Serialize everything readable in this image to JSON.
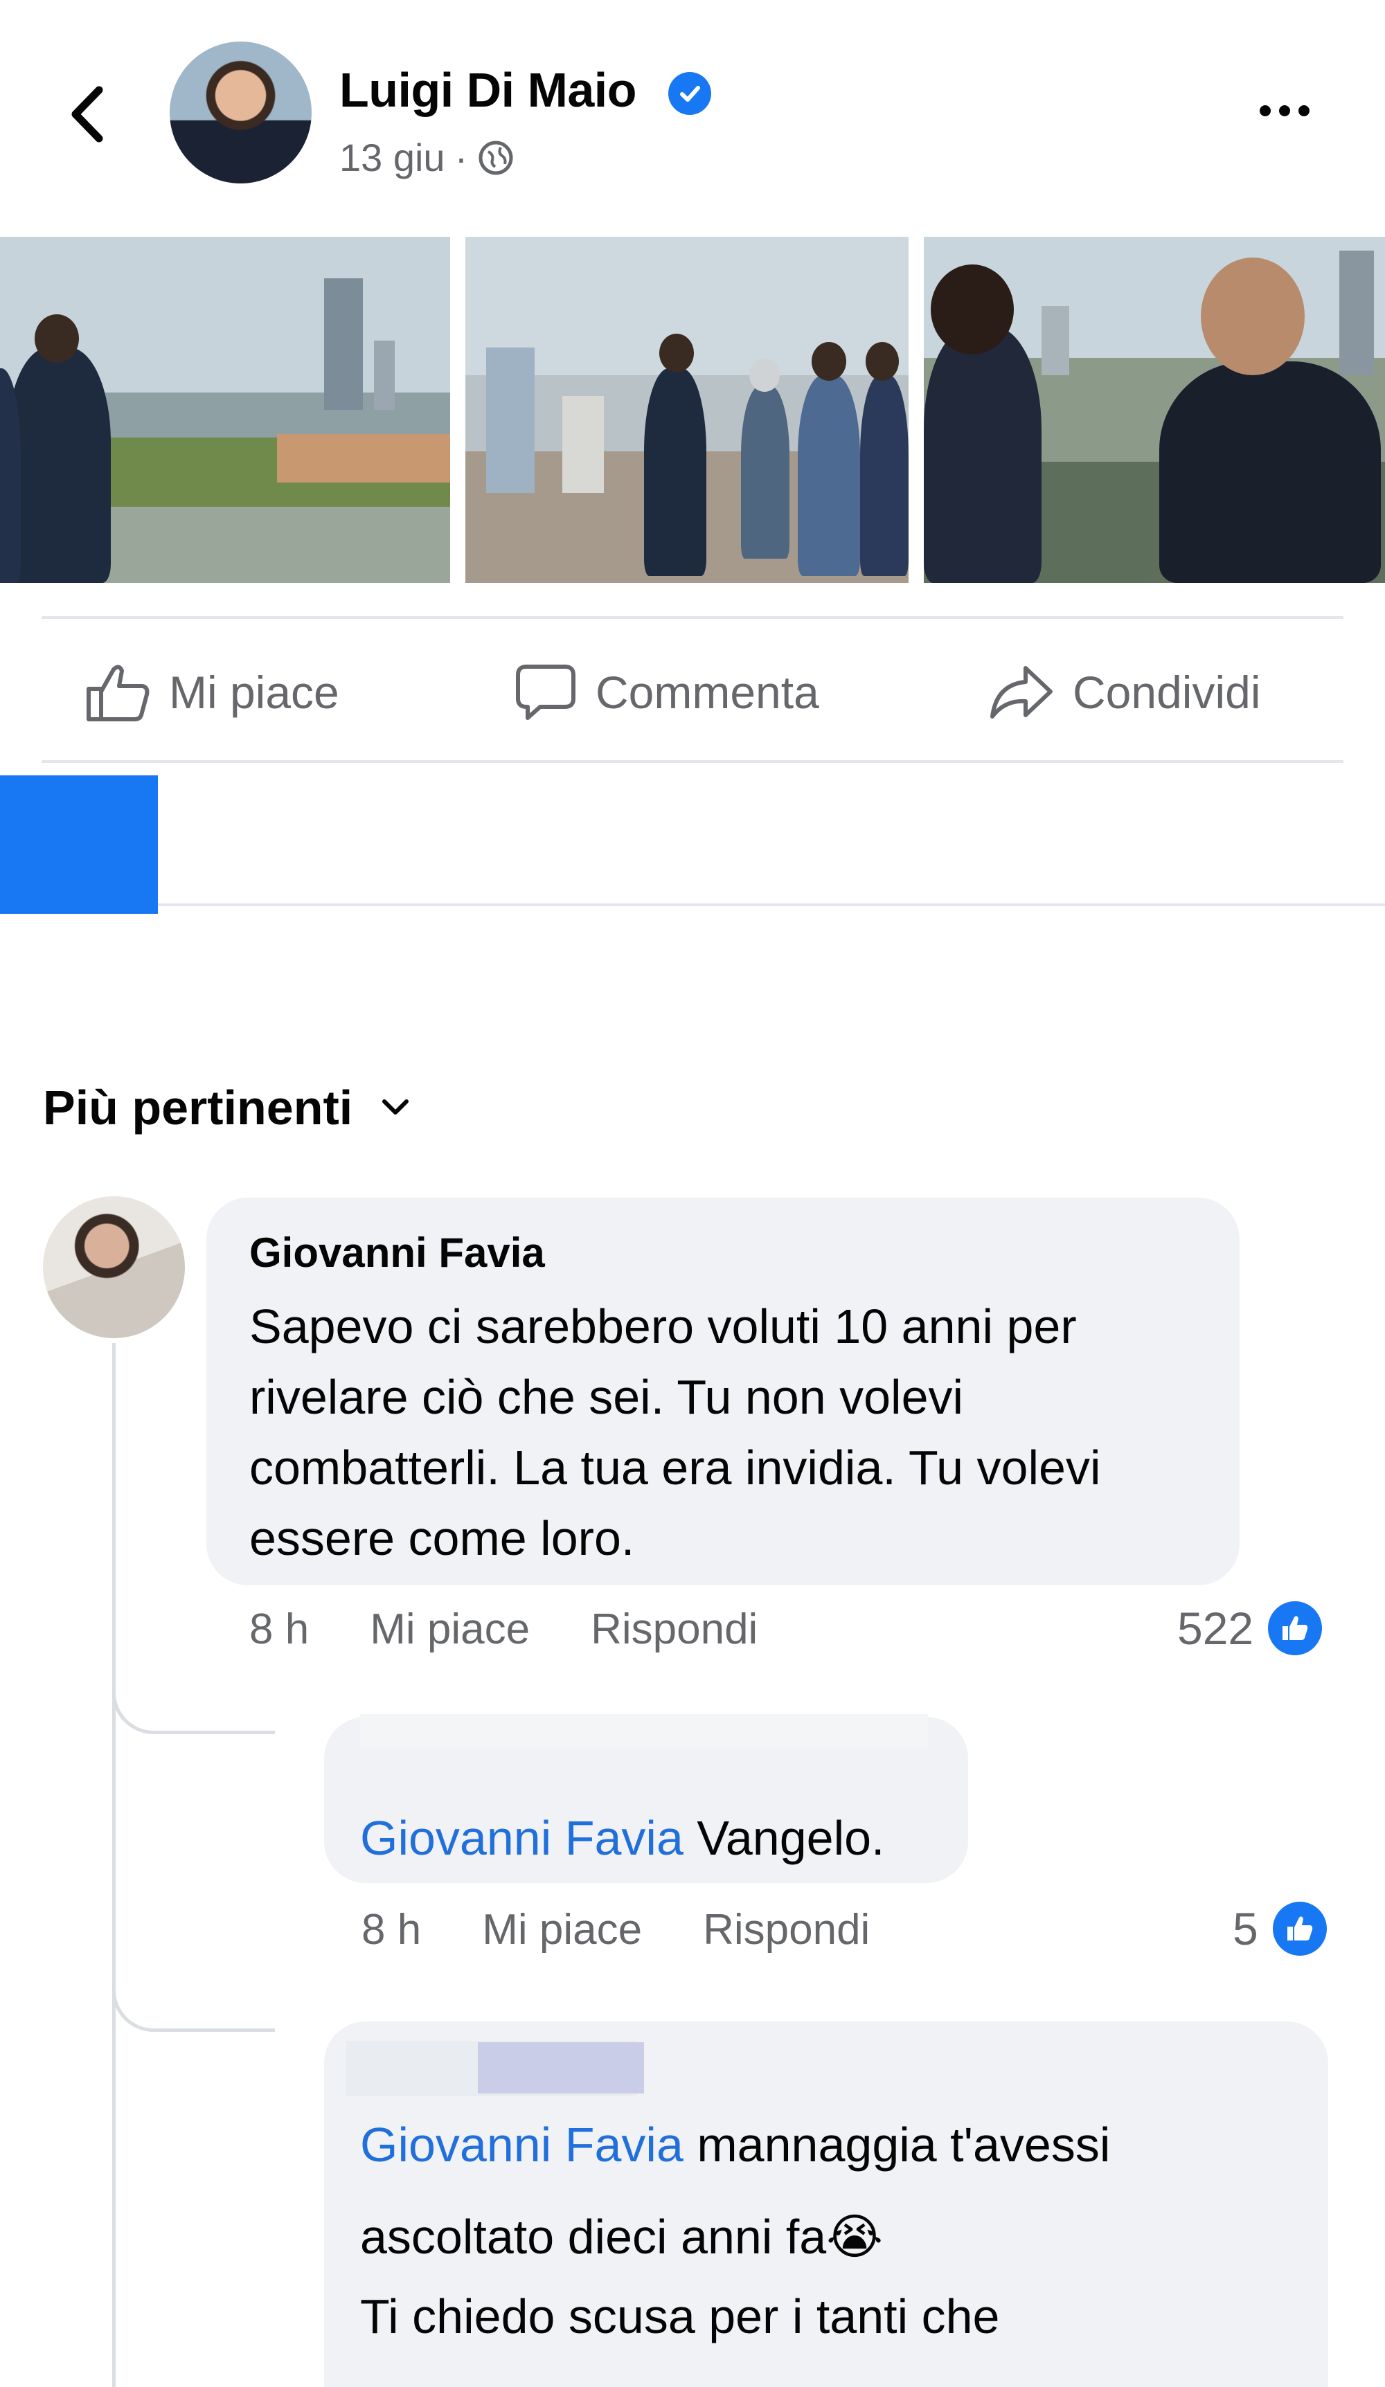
{
  "post": {
    "author": "Luigi Di Maio",
    "date": "13 giu",
    "meta_separator": "·"
  },
  "actions": {
    "like": "Mi piace",
    "comment": "Commenta",
    "share": "Condividi"
  },
  "comments_sort": "Più pertinenti",
  "comments": [
    {
      "author": "Giovanni Favia",
      "text": "Sapevo ci sarebbero voluti 10 anni per rivelare ciò che sei. Tu non volevi combatterli. La tua era invidia. Tu volevi essere come loro.",
      "time": "8 h",
      "like_label": "Mi piace",
      "reply_label": "Rispondi",
      "reactions": "522"
    },
    {
      "mention": "Giovanni Favia",
      "text": "Vangelo.",
      "time": "8 h",
      "like_label": "Mi piace",
      "reply_label": "Rispondi",
      "reactions": "5"
    },
    {
      "mention": "Giovanni Favia",
      "line1": "mannaggia t'avessi",
      "line2": "ascoltato dieci anni fa",
      "emoji": "😭",
      "line3": "Ti chiedo scusa per i tanti che"
    }
  ],
  "colors": {
    "accent": "#1877f2",
    "mention": "#216fdb",
    "secondary_text": "#65676b",
    "bubble": "#f0f2f5"
  }
}
